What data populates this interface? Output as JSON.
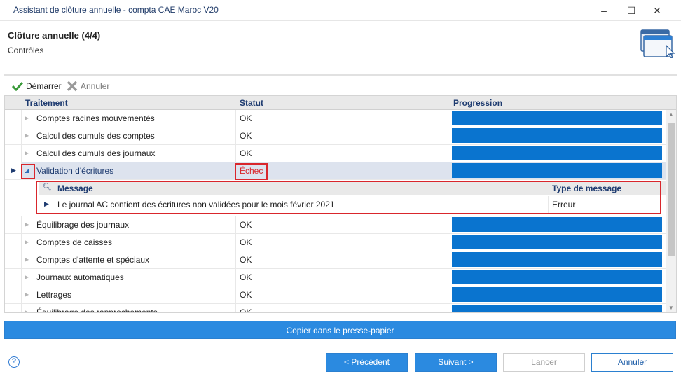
{
  "window": {
    "title": "Assistant de clôture annuelle - compta CAE Maroc V20",
    "minimize": "–",
    "maximize": "☐",
    "close": "✕"
  },
  "header": {
    "title": "Clôture annuelle (4/4)",
    "subtitle": "Contrôles",
    "icon": "window-cursor-icon"
  },
  "toolbar": {
    "start_label": "Démarrer",
    "cancel_label": "Annuler"
  },
  "grid": {
    "columns": [
      "Traitement",
      "Statut",
      "Progression"
    ],
    "rows": [
      {
        "name": "Comptes racines mouvementés",
        "status": "OK",
        "progress": 1.0
      },
      {
        "name": "Calcul des cumuls des comptes",
        "status": "OK",
        "progress": 1.0
      },
      {
        "name": "Calcul des cumuls des journaux",
        "status": "OK",
        "progress": 1.0
      },
      {
        "name": "Validation d'écritures",
        "status": "Échec",
        "progress": 1.0
      },
      {
        "name": "Équilibrage des journaux",
        "status": "OK",
        "progress": 1.0
      },
      {
        "name": "Comptes de caisses",
        "status": "OK",
        "progress": 1.0
      },
      {
        "name": "Comptes d'attente et spéciaux",
        "status": "OK",
        "progress": 1.0
      },
      {
        "name": "Journaux automatiques",
        "status": "OK",
        "progress": 1.0
      },
      {
        "name": "Lettrages",
        "status": "OK",
        "progress": 1.0
      },
      {
        "name": "Équilibrage des rapprochements",
        "status": "OK",
        "progress": 1.0
      }
    ],
    "detail": {
      "columns": [
        "Message",
        "Type de message"
      ],
      "rows": [
        {
          "message": "Le journal AC contient des écritures non validées pour le mois février 2021",
          "type": "Erreur"
        }
      ]
    }
  },
  "copy_button": "Copier dans le presse-papier",
  "footer": {
    "help": "?",
    "previous": "< Précédent",
    "next": "Suivant >",
    "launch": "Lancer",
    "cancel": "Annuler"
  },
  "colors": {
    "accent": "#2b8ae0",
    "progress": "#0a74cf",
    "error": "#d9262c",
    "header_text": "#1e3b70"
  }
}
